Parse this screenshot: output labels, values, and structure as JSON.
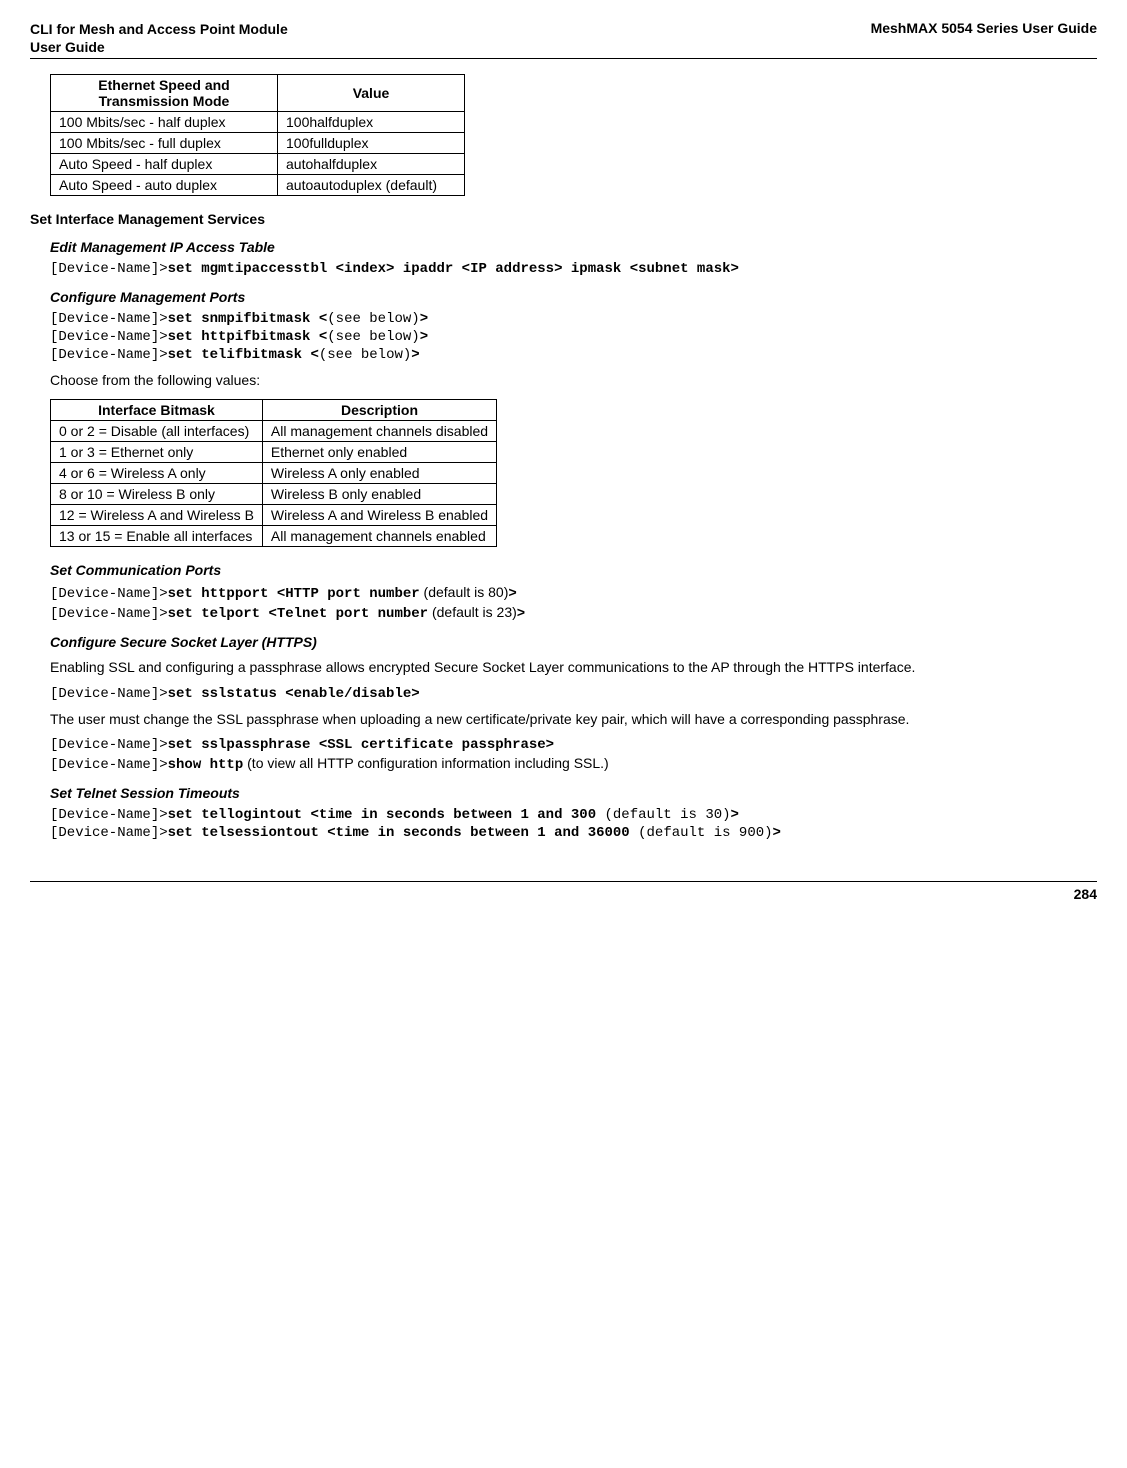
{
  "header": {
    "left_line1": "CLI for Mesh and Access Point Module",
    "left_line2": " User Guide",
    "right": "MeshMAX 5054 Series User Guide"
  },
  "table1": {
    "headers": [
      "Ethernet Speed and Transmission Mode",
      "Value"
    ],
    "rows": [
      [
        "100 Mbits/sec - half duplex",
        "100halfduplex"
      ],
      [
        "100 Mbits/sec - full duplex",
        "100fullduplex"
      ],
      [
        "Auto Speed - half duplex",
        "autohalfduplex"
      ],
      [
        "Auto Speed - auto duplex",
        "autoautoduplex (default)"
      ]
    ]
  },
  "section1_title": "Set Interface Management Services",
  "edit_mgmt": {
    "title": "Edit Management IP Access Table",
    "prompt": "[Device-Name]>",
    "cmd": "set mgmtipaccesstbl <index> ipaddr <IP address> ipmask <subnet mask>"
  },
  "config_mgmt": {
    "title": "Configure Management Ports",
    "lines": [
      {
        "prompt": "[Device-Name]>",
        "bold1": "set snmpifbitmask <",
        "plain": "(see below)",
        "bold2": ">"
      },
      {
        "prompt": "[Device-Name]>",
        "bold1": "set httpifbitmask <",
        "plain": "(see below)",
        "bold2": ">"
      },
      {
        "prompt": "[Device-Name]>",
        "bold1": "set telifbitmask <",
        "plain": "(see below)",
        "bold2": ">"
      }
    ],
    "choose_text": "Choose from the following values:"
  },
  "table2": {
    "headers": [
      "Interface Bitmask",
      "Description"
    ],
    "rows": [
      [
        "0 or 2 = Disable (all interfaces)",
        "All management channels disabled"
      ],
      [
        "1 or 3 = Ethernet only",
        "Ethernet only enabled"
      ],
      [
        "4 or 6 = Wireless A only",
        "Wireless A only enabled"
      ],
      [
        "8 or 10 = Wireless B only",
        "Wireless B only enabled"
      ],
      [
        "12 = Wireless A and Wireless B",
        "Wireless A and Wireless B enabled"
      ],
      [
        "13 or 15 = Enable all interfaces",
        "All management channels enabled"
      ]
    ]
  },
  "comm_ports": {
    "title": "Set Communication Ports",
    "lines": [
      {
        "prompt": "[Device-Name]>",
        "bold1": "set httpport <HTTP port number",
        "plain": " (default is 80)",
        "bold2": ">"
      },
      {
        "prompt": "[Device-Name]>",
        "bold1": "set telport <Telnet port number",
        "plain": " (default is 23)",
        "bold2": ">"
      }
    ]
  },
  "ssl": {
    "title": "Configure Secure Socket Layer (HTTPS)",
    "para1": "Enabling SSL and configuring a passphrase allows encrypted Secure Socket Layer communications to the AP through the HTTPS interface.",
    "line1_prompt": "[Device-Name]>",
    "line1_cmd": "set sslstatus <enable/disable>",
    "para2": "The user must change the SSL passphrase when uploading a new certificate/private key pair, which will have a corresponding passphrase.",
    "line2_prompt": "[Device-Name]>",
    "line2_cmd": "set sslpassphrase <SSL certificate passphrase>",
    "line3_prompt": "[Device-Name]>",
    "line3_cmd": "show http",
    "line3_plain": " (to view all HTTP configuration information including SSL.)"
  },
  "telnet": {
    "title": "Set Telnet Session Timeouts",
    "lines": [
      {
        "prompt": "[Device-Name]>",
        "bold1": "set tellogintout <time in seconds between 1 and 300 ",
        "plain": "(default is 30)",
        "bold2": ">"
      },
      {
        "prompt": "[Device-Name]>",
        "bold1": "set telsessiontout <time in seconds between 1 and 36000 ",
        "plain": "(default is 900)",
        "bold2": ">"
      }
    ]
  },
  "footer": {
    "page": "284"
  }
}
